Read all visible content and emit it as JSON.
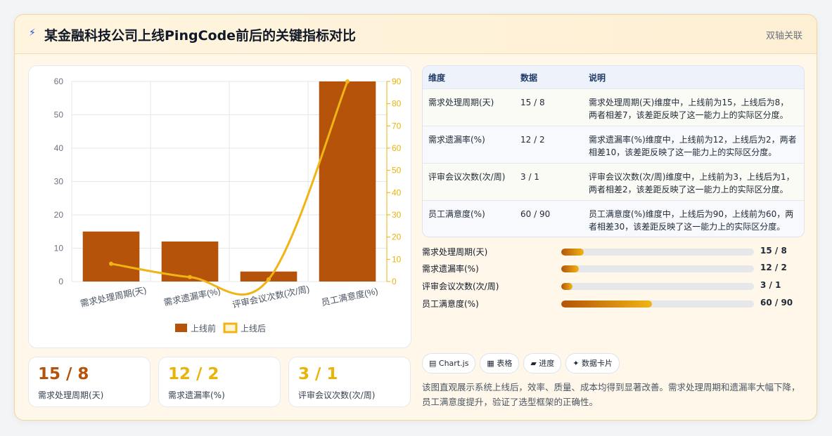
{
  "header": {
    "icon": "bolt-icon",
    "title": "某金融科技公司上线PingCode前后的关键指标对比",
    "tag": "双轴关联"
  },
  "colors": {
    "bar": "#b45309",
    "line": "#f0b514",
    "accent_left": "#b45309",
    "accent_right": "#eab308"
  },
  "chart_data": {
    "type": "bar",
    "categories": [
      "需求处理周期(天)",
      "需求遗漏率(%)",
      "评审会议次数(次/周)",
      "员工满意度(%)"
    ],
    "series": [
      {
        "name": "上线前",
        "type": "bar",
        "axis": "left",
        "values": [
          15,
          12,
          3,
          60
        ]
      },
      {
        "name": "上线后",
        "type": "line",
        "axis": "right",
        "values": [
          8,
          2,
          1,
          90
        ]
      }
    ],
    "y_left": {
      "min": 0,
      "max": 60,
      "ticks": [
        "0",
        "10",
        "20",
        "30",
        "40",
        "50",
        "60"
      ]
    },
    "y_right": {
      "min": 0,
      "max": 90,
      "ticks": [
        "0",
        "10",
        "20",
        "30",
        "40",
        "50",
        "60",
        "70",
        "80",
        "90"
      ]
    },
    "legend": {
      "position": "bottom",
      "items": [
        "上线前",
        "上线后"
      ]
    },
    "grid": true
  },
  "kpis": [
    {
      "value": "15 / 8",
      "label": "需求处理周期(天)"
    },
    {
      "value": "12 / 2",
      "label": "需求遗漏率(%)"
    },
    {
      "value": "3 / 1",
      "label": "评审会议次数(次/周)"
    }
  ],
  "table": {
    "headers": [
      "维度",
      "数据",
      "说明"
    ],
    "rows": [
      {
        "dim": "需求处理周期(天)",
        "data": "15 / 8",
        "desc": "需求处理周期(天)维度中，上线前为15，上线后为8，两者相差7，该差距反映了这一能力上的实际区分度。"
      },
      {
        "dim": "需求遗漏率(%)",
        "data": "12 / 2",
        "desc": "需求遗漏率(%)维度中，上线前为12，上线后为2，两者相差10，该差距反映了这一能力上的实际区分度。"
      },
      {
        "dim": "评审会议次数(次/周)",
        "data": "3 / 1",
        "desc": "评审会议次数(次/周)维度中，上线前为3，上线后为1，两者相差2，该差距反映了这一能力上的实际区分度。"
      },
      {
        "dim": "员工满意度(%)",
        "data": "60 / 90",
        "desc": "员工满意度(%)维度中，上线后为90，上线前为60，两者相差30，该差距反映了这一能力上的实际区分度。"
      }
    ]
  },
  "progress": [
    {
      "label": "需求处理周期(天)",
      "value": "15 / 8",
      "fraction": 0.115
    },
    {
      "label": "需求遗漏率(%)",
      "value": "12 / 2",
      "fraction": 0.092
    },
    {
      "label": "评审会议次数(次/周)",
      "value": "3 / 1",
      "fraction": 0.06
    },
    {
      "label": "员工满意度(%)",
      "value": "60 / 90",
      "fraction": 0.47
    }
  ],
  "chips": [
    {
      "icon": "chart-icon",
      "glyph": "▤",
      "label": "Chart.js"
    },
    {
      "icon": "table-icon",
      "glyph": "▦",
      "label": "表格"
    },
    {
      "icon": "progress-icon",
      "glyph": "▰",
      "label": "进度"
    },
    {
      "icon": "sparkle-icon",
      "glyph": "✦",
      "label": "数据卡片"
    }
  ],
  "summary": "该图直观展示系统上线后，效率、质量、成本均得到显著改善。需求处理周期和遗漏率大幅下降，员工满意度提升，验证了选型框架的正确性。"
}
